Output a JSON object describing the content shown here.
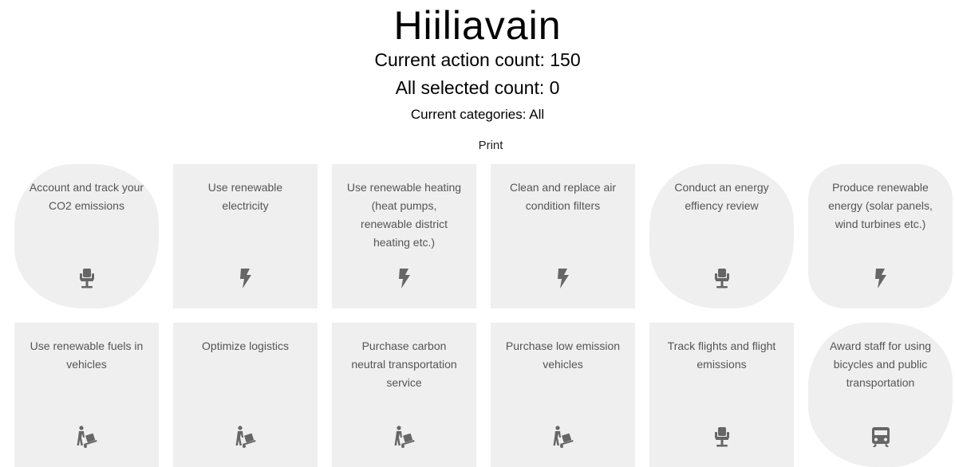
{
  "header": {
    "title": "Hiiliavain",
    "action_count": "Current action count: 150",
    "selected_count": "All selected count: 0",
    "categories": "Current categories: All",
    "print_label": "Print"
  },
  "cards": [
    {
      "label": "Account and track your CO2 emissions",
      "icon": "office-chair-icon"
    },
    {
      "label": "Use renewable electricity",
      "icon": "lightning-bolt-icon"
    },
    {
      "label": "Use renewable heating (heat pumps, renewable district heating etc.)",
      "icon": "lightning-bolt-icon"
    },
    {
      "label": "Clean and replace air condition filters",
      "icon": "lightning-bolt-icon"
    },
    {
      "label": "Conduct an energy effiency review",
      "icon": "office-chair-icon"
    },
    {
      "label": "Produce renewable energy (solar panels, wind turbines etc.)",
      "icon": "lightning-bolt-icon"
    },
    {
      "label": "Use renewable fuels in vehicles",
      "icon": "hand-truck-icon"
    },
    {
      "label": "Optimize logistics",
      "icon": "hand-truck-icon"
    },
    {
      "label": "Purchase carbon neutral transportation service",
      "icon": "hand-truck-icon"
    },
    {
      "label": "Purchase low emission vehicles",
      "icon": "hand-truck-icon"
    },
    {
      "label": "Track flights and flight emissions",
      "icon": "office-chair-icon"
    },
    {
      "label": "Award staff for using bicycles and public transportation",
      "icon": "train-icon"
    }
  ]
}
